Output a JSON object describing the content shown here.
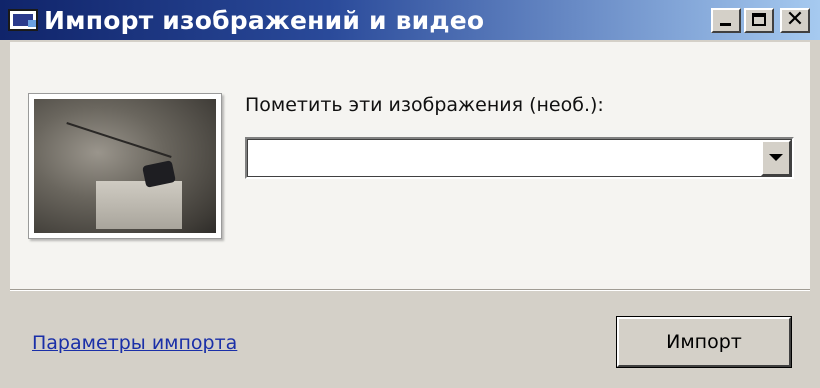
{
  "window": {
    "title": "Импорт изображений и видео",
    "title_bar_color_start": "#10246a",
    "title_bar_color_end": "#a6caf0",
    "icons": {
      "app": "camera-import-icon",
      "minimize": "minimize-icon",
      "maximize": "maximize-icon",
      "close": "close-icon"
    },
    "close_glyph": "✕"
  },
  "main": {
    "thumbnail_icon": "photo-thumbnail",
    "tag_label": "Пометить эти изображения (необ.):",
    "tag_combo": {
      "value": "",
      "arrow_icon": "chevron-down-icon"
    }
  },
  "footer": {
    "params_link": "Параметры импорта",
    "import_button": "Импорт",
    "link_color": "#1a2fa8"
  }
}
